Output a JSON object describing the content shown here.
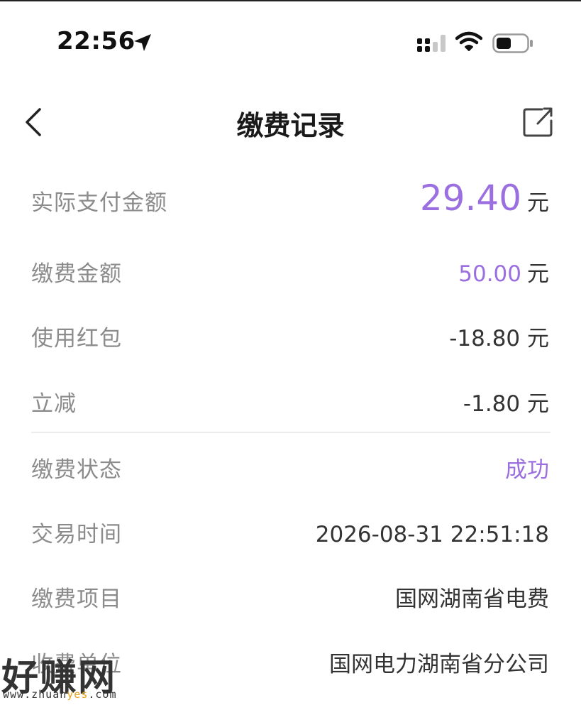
{
  "status_bar": {
    "time": "22:56"
  },
  "nav": {
    "title": "缴费记录"
  },
  "rows": {
    "actual_paid": {
      "label": "实际支付金额",
      "value": "29.40",
      "unit": "元"
    },
    "payment_amount": {
      "label": "缴费金额",
      "value": "50.00",
      "unit": "元"
    },
    "red_packet": {
      "label": "使用红包",
      "value": "-18.80 元"
    },
    "instant_discount": {
      "label": "立减",
      "value": "-1.80 元"
    },
    "status": {
      "label": "缴费状态",
      "value": "成功"
    },
    "trade_time": {
      "label": "交易时间",
      "value": "2026-08-31 22:51:18"
    },
    "item": {
      "label": "缴费项目",
      "value": "国网湖南省电费"
    },
    "payee": {
      "label": "收费单位",
      "value": "国网电力湖南省分公司"
    }
  },
  "watermark": {
    "big": "好赚网",
    "url_prefix": "www.zhuan",
    "url_highlight": "yes",
    "url_suffix": ".com"
  },
  "colors": {
    "accent": "#9b6fe0",
    "label": "#8b8b8b",
    "value": "#333333"
  },
  "icons": {
    "location": "location-arrow-icon",
    "signal": "cellular-signal-icon",
    "wifi": "wifi-icon",
    "battery": "battery-icon",
    "back": "chevron-left-icon",
    "share": "share-icon"
  }
}
